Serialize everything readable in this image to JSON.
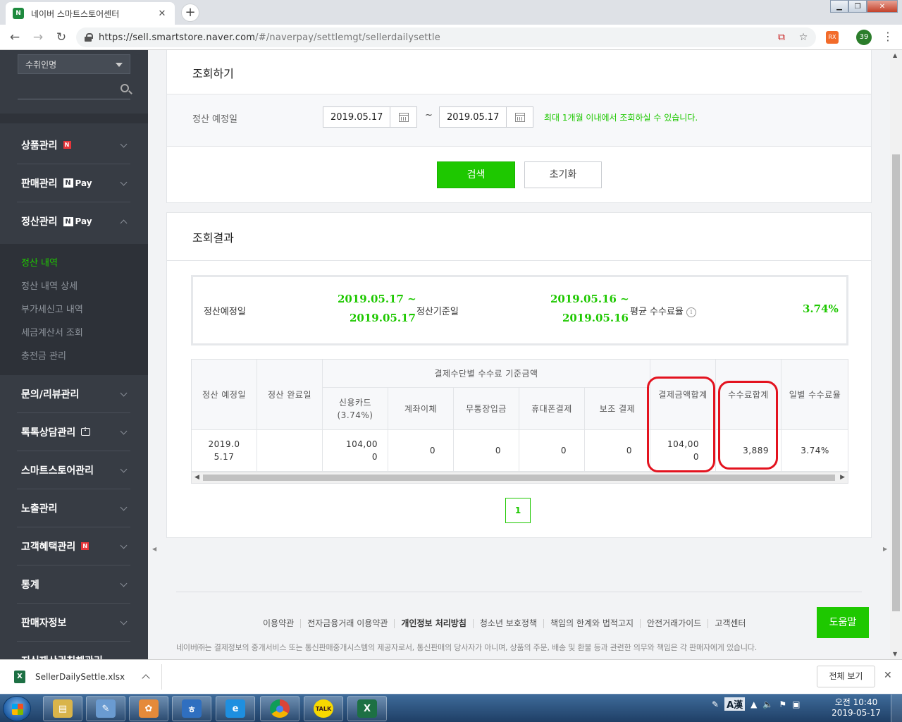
{
  "browser": {
    "tab_title": "네이버 스마트스토어센터",
    "favicon_text": "N",
    "tab_close": "✕",
    "newtab": "+",
    "url_host": "https://sell.smartstore.naver.com",
    "url_path": "/#/naverpay/settlemgt/sellerdailysettle",
    "ext_label": "RX",
    "profile_count": "39",
    "window_min": "▁",
    "window_max": "❐",
    "window_close": "✕",
    "back": "←",
    "forward": "→",
    "reload": "↻",
    "bookmark": "☆",
    "cast": "⧉",
    "menu": "⋮"
  },
  "sidebar": {
    "select_value": "수취인명",
    "menu": [
      {
        "label": "상품관리",
        "badge": "N"
      },
      {
        "label": "판매관리",
        "badge": "Pay"
      },
      {
        "label": "정산관리",
        "badge": "Pay"
      },
      {
        "label": "문의/리뷰관리"
      },
      {
        "label": "톡톡상담관리"
      },
      {
        "label": "스마트스토어관리"
      },
      {
        "label": "노출관리"
      },
      {
        "label": "고객혜택관리",
        "badge": "N"
      },
      {
        "label": "통계"
      },
      {
        "label": "판매자정보"
      },
      {
        "label": "지식재산권침해관리"
      }
    ],
    "npay_n": "N",
    "submenu": [
      "정산 내역",
      "정산 내역 상세",
      "부가세신고 내역",
      "세금계산서 조회",
      "충전금 관리"
    ],
    "active_sub": "정산 내역"
  },
  "search": {
    "title": "조회하기",
    "field_label": "정산 예정일",
    "date_from": "2019.05.17",
    "tilde": "~",
    "date_to": "2019.05.17",
    "hint": "최대 1개월 이내에서 조회하실 수 있습니다.",
    "search_button": "검색",
    "reset_button": "초기화"
  },
  "result": {
    "title": "조회결과",
    "summary": {
      "label_settle_due": "정산예정일",
      "settle_due_from": "2019.05.17 ~",
      "settle_due_to": "2019.05.17",
      "label_base": "정산기준일",
      "base_from": "2019.05.16 ~",
      "base_to": "2019.05.16",
      "label_avg_fee": "평균 수수료율",
      "info_icon": "i",
      "avg_fee": "3.74%"
    },
    "table": {
      "group_header": "결제수단별 수수료 기준금액",
      "headers": {
        "settle_due": "정산 예정일",
        "settle_done": "정산 완료일",
        "card_line1": "신용카드",
        "card_line2": "(3.74%)",
        "transfer": "계좌이체",
        "deposit": "무통장입금",
        "mobile": "휴대폰결제",
        "sub_pay": "보조 결제",
        "pay_total": "결제금액합계",
        "fee_total": "수수료합계",
        "daily_fee": "일별 수수료율"
      },
      "row": {
        "settle_due_line1": "2019.0",
        "settle_due_line2": "5.17",
        "settle_done": "",
        "card_line1": "104,00",
        "card_line2": "0",
        "transfer": "0",
        "deposit": "0",
        "mobile": "0",
        "sub_pay": "0",
        "pay_total_line1": "104,00",
        "pay_total_line2": "0",
        "fee_total": "3,889",
        "daily_fee": "3.74%"
      }
    },
    "page": "1"
  },
  "footer": {
    "links": [
      "이용약관",
      "전자금융거래 이용약관",
      "개인정보 처리방침",
      "청소년 보호정책",
      "책임의 한계와 법적고지",
      "안전거래가이드",
      "고객센터"
    ],
    "notice": "네이버㈜는 결제정보의 중개서비스 또는 통신판매중개시스템의 제공자로서, 통신판매의 당사자가 아니며, 상품의 주문, 배송 및 환불 등과 관련한 의무와 책임은 각 판매자에게 있습니다.",
    "help_button": "도움말"
  },
  "download": {
    "file_name": "SellerDailySettle.xlsx",
    "show_all": "전체 보기",
    "close": "✕"
  },
  "taskbar": {
    "ime_label": "A漢",
    "time": "오전 10:40",
    "date": "2019-05-17",
    "apps": [
      {
        "name": "explorer",
        "glyph": "▤",
        "color": "#d9b44a"
      },
      {
        "name": "notepad",
        "glyph": "✎",
        "color": "#6a9bd1"
      },
      {
        "name": "paint",
        "glyph": "✿",
        "color": "#e58a3a"
      },
      {
        "name": "hangul",
        "glyph": "ㅎ",
        "color": "#2f6fc0"
      },
      {
        "name": "ie",
        "glyph": "e",
        "color": "#1e8fe0"
      },
      {
        "name": "chrome",
        "glyph": "●",
        "color": "#3aa757"
      },
      {
        "name": "kakaotalk",
        "glyph": "TALK",
        "color": "#f7d900"
      },
      {
        "name": "excel",
        "glyph": "X",
        "color": "#1d7044"
      }
    ]
  }
}
